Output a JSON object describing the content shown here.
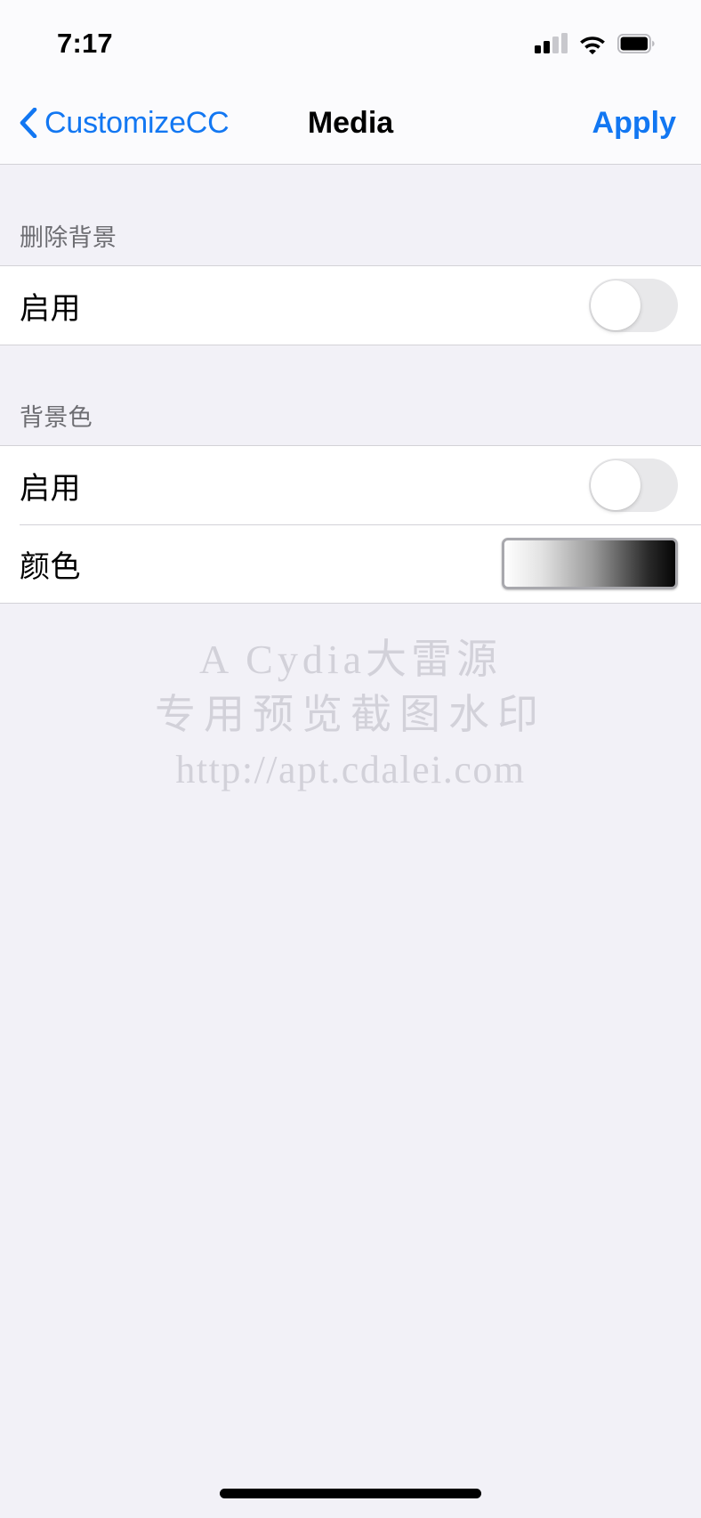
{
  "status_bar": {
    "time": "7:17",
    "signal_icon": "cellular-signal-icon",
    "signal_bars_filled": 2,
    "signal_bars_total": 4,
    "wifi_icon": "wifi-icon",
    "battery_icon": "battery-icon",
    "battery_level_percent": 90
  },
  "nav": {
    "back_label": "CustomizeCC",
    "back_icon": "chevron-left-icon",
    "title": "Media",
    "apply_label": "Apply",
    "accent_color": "#1277f2"
  },
  "sections": [
    {
      "header": "删除背景",
      "rows": [
        {
          "label": "启用",
          "accessory": "toggle",
          "value": "off"
        }
      ]
    },
    {
      "header": "背景色",
      "rows": [
        {
          "label": "启用",
          "accessory": "toggle",
          "value": "off"
        },
        {
          "label": "颜色",
          "accessory": "color-swatch",
          "value": "gradient-white-to-black"
        }
      ]
    }
  ],
  "watermark": {
    "line1": "A Cydia大雷源",
    "line2": "专用预览截图水印",
    "line3": "http://apt.cdalei.com",
    "color": "#d2d1d9"
  },
  "home_indicator": {
    "label": "home-indicator"
  },
  "theme": {
    "page_background": "#f2f1f7",
    "cell_background": "#ffffff",
    "separator": "#d3d2d7",
    "header_text": "#6d6d72",
    "toggle_off_track": "#e8e8ea"
  }
}
